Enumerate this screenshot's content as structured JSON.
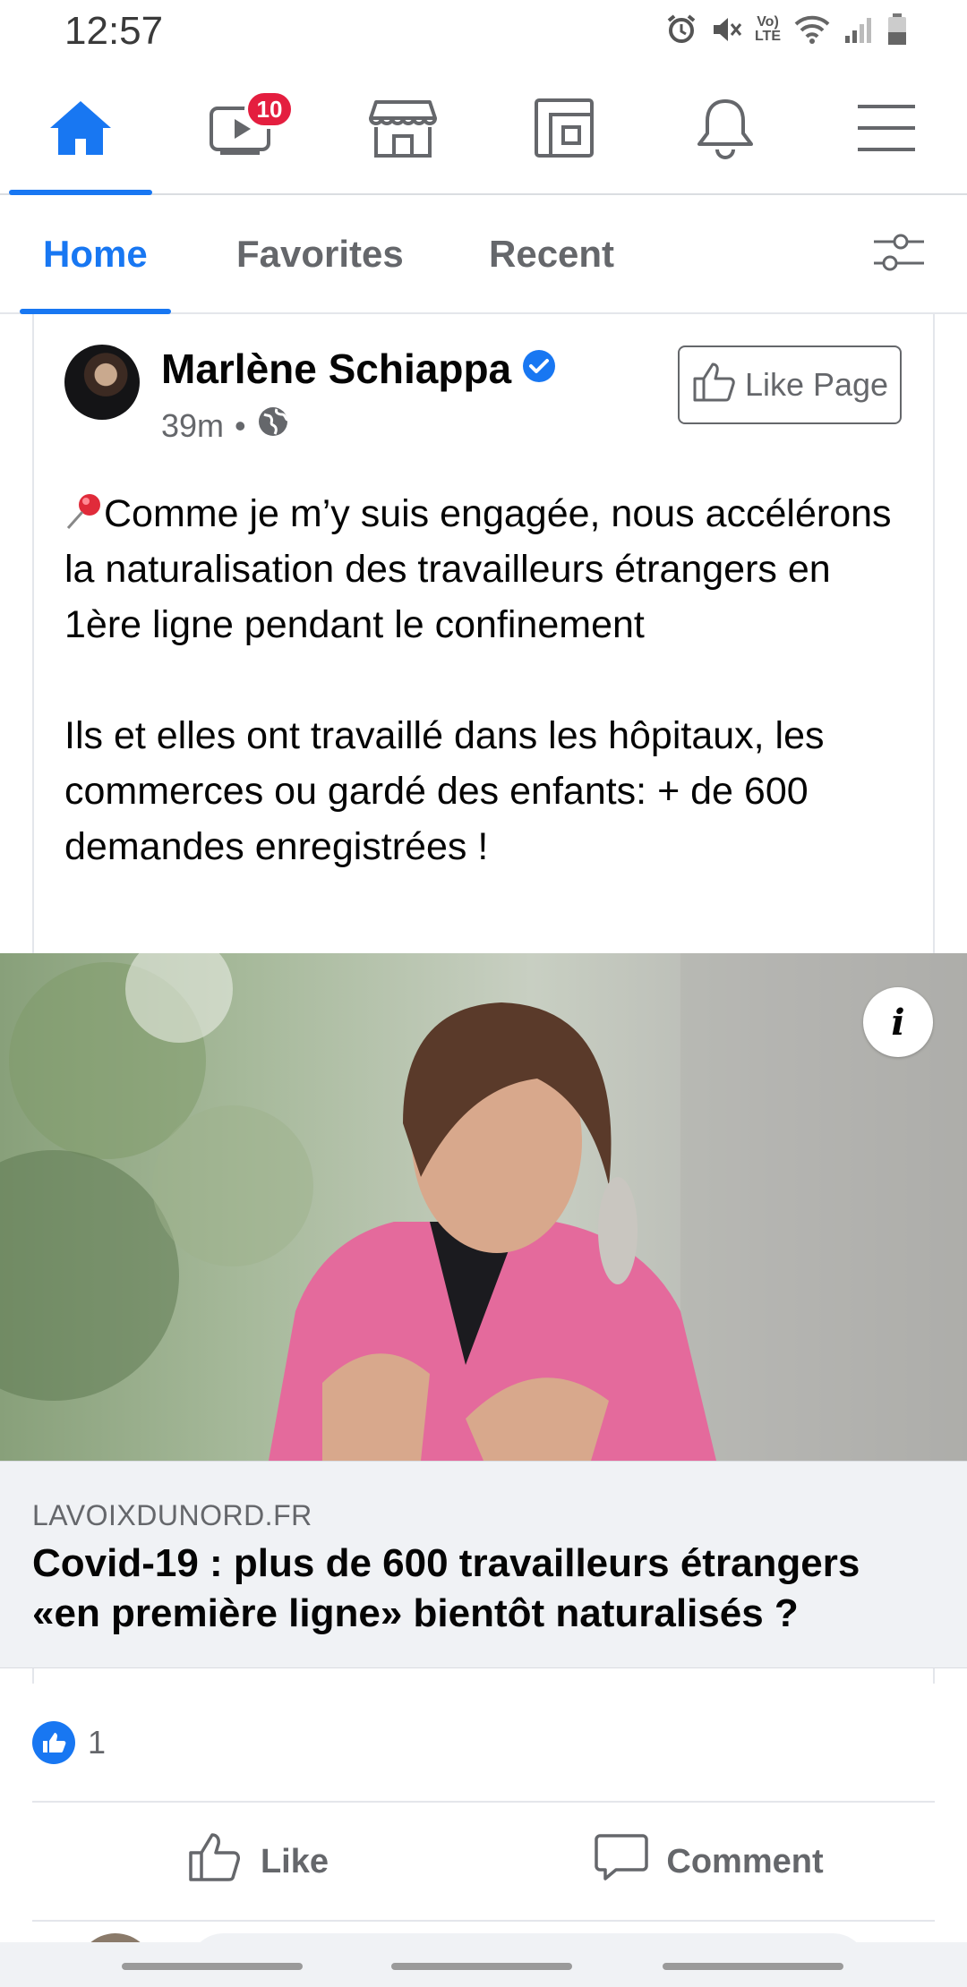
{
  "status_bar": {
    "time": "12:57",
    "lte_top": "Vo)",
    "lte_bottom": "LTE",
    "icons": [
      "alarm-icon",
      "mute-icon",
      "volte-icon",
      "wifi-icon",
      "signal-icon",
      "battery-icon"
    ]
  },
  "top_nav": {
    "items": [
      {
        "icon": "home-icon",
        "active": true
      },
      {
        "icon": "watch-icon",
        "badge": "10"
      },
      {
        "icon": "marketplace-icon"
      },
      {
        "icon": "pages-icon"
      },
      {
        "icon": "bell-icon"
      },
      {
        "icon": "menu-icon"
      }
    ],
    "accent_color": "#1877f2",
    "badge_color": "#e41e3f"
  },
  "sub_tabs": {
    "tabs": [
      "Home",
      "Favorites",
      "Recent"
    ],
    "active": "Home"
  },
  "post": {
    "author": "Marlène Schiappa",
    "verified": true,
    "time": "39m",
    "separator": "•",
    "audience_icon": "globe-icon",
    "like_page_label": "Like Page",
    "text_lines": [
      "Comme je m’y suis engagée, nous accélérons la naturalisation des travailleurs étrangers en 1ère ligne pendant le confinement",
      "Ils et elles ont travaillé dans les hôpitaux, les commerces ou gardé des enfants: + de 600 demandes enregistrées !"
    ],
    "link": {
      "domain": "LAVOIXDUNORD.FR",
      "title": "Covid-19 : plus de 600 travailleurs étrangers «en première ligne» bientôt naturalisés ?",
      "info_label": "i"
    },
    "reactions": {
      "count": "1",
      "icon": "like-reaction-icon"
    },
    "actions": {
      "like": "Like",
      "comment": "Comment"
    }
  }
}
